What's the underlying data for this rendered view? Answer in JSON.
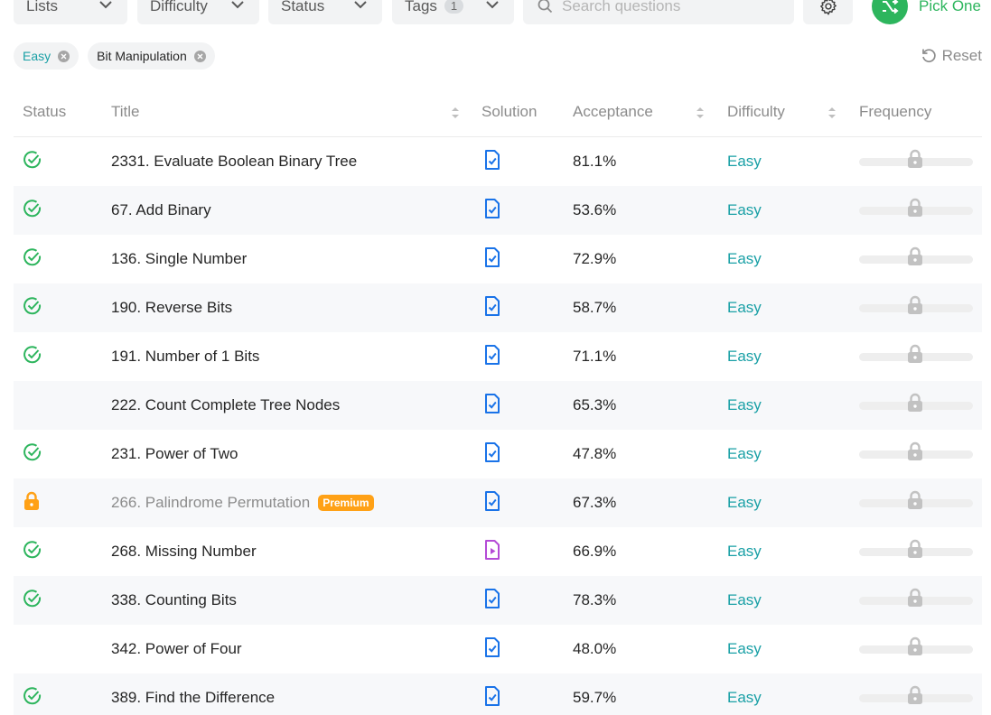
{
  "toolbar": {
    "lists_label": "Lists",
    "difficulty_label": "Difficulty",
    "status_label": "Status",
    "tags_label": "Tags",
    "tags_count": "1",
    "search_placeholder": "Search questions",
    "pick_one_label": "Pick One"
  },
  "filters": {
    "chips": [
      "Easy",
      "Bit Manipulation"
    ],
    "reset_label": "Reset"
  },
  "table": {
    "headers": {
      "status": "Status",
      "title": "Title",
      "solution": "Solution",
      "acceptance": "Acceptance",
      "difficulty": "Difficulty",
      "frequency": "Frequency"
    },
    "rows": [
      {
        "status": "solved",
        "title": "2331. Evaluate Boolean Binary Tree",
        "solution": "article",
        "acceptance": "81.1%",
        "difficulty": "Easy"
      },
      {
        "status": "solved",
        "title": "67. Add Binary",
        "solution": "article",
        "acceptance": "53.6%",
        "difficulty": "Easy"
      },
      {
        "status": "solved",
        "title": "136. Single Number",
        "solution": "article",
        "acceptance": "72.9%",
        "difficulty": "Easy"
      },
      {
        "status": "solved",
        "title": "190. Reverse Bits",
        "solution": "article",
        "acceptance": "58.7%",
        "difficulty": "Easy"
      },
      {
        "status": "solved",
        "title": "191. Number of 1 Bits",
        "solution": "article",
        "acceptance": "71.1%",
        "difficulty": "Easy"
      },
      {
        "status": "none",
        "title": "222. Count Complete Tree Nodes",
        "solution": "article",
        "acceptance": "65.3%",
        "difficulty": "Easy"
      },
      {
        "status": "solved",
        "title": "231. Power of Two",
        "solution": "article",
        "acceptance": "47.8%",
        "difficulty": "Easy"
      },
      {
        "status": "locked",
        "title": "266. Palindrome Permutation",
        "badge": "Premium",
        "solution": "article",
        "acceptance": "67.3%",
        "difficulty": "Easy"
      },
      {
        "status": "solved",
        "title": "268. Missing Number",
        "solution": "video",
        "acceptance": "66.9%",
        "difficulty": "Easy"
      },
      {
        "status": "solved",
        "title": "338. Counting Bits",
        "solution": "article",
        "acceptance": "78.3%",
        "difficulty": "Easy"
      },
      {
        "status": "none",
        "title": "342. Power of Four",
        "solution": "article",
        "acceptance": "48.0%",
        "difficulty": "Easy"
      },
      {
        "status": "solved",
        "title": "389. Find the Difference",
        "solution": "article",
        "acceptance": "59.7%",
        "difficulty": "Easy"
      }
    ]
  },
  "colors": {
    "accent_green": "#2db55d",
    "easy_teal": "#1aa0a6",
    "premium_orange": "#ffa116",
    "solution_blue": "#1a73e8",
    "video_purple": "#b44bd6"
  }
}
